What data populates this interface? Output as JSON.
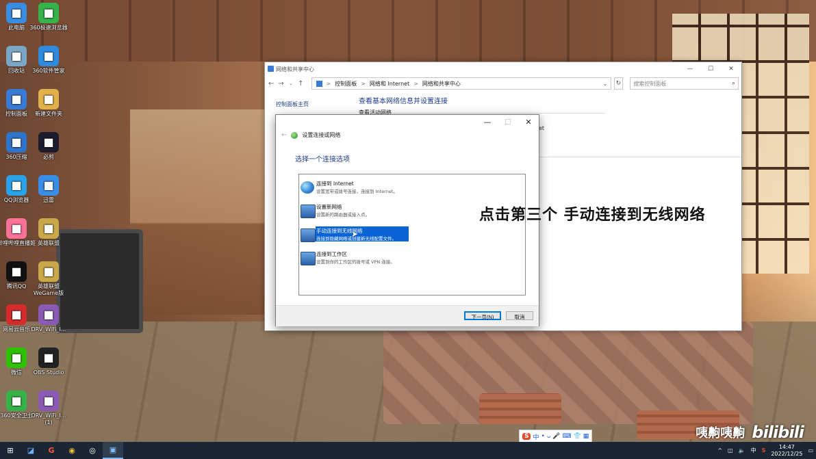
{
  "desktop": {
    "icons": [
      {
        "label": "此电脑",
        "icon": "computer-icon",
        "color": "#3a8de0"
      },
      {
        "label": "360极速浏览器",
        "icon": "browser-icon",
        "color": "#35b34a"
      },
      {
        "label": "回收站",
        "icon": "recycle-bin-icon",
        "color": "#7aa7c7"
      },
      {
        "label": "360软件管家",
        "icon": "software-manager-icon",
        "color": "#2e8be0"
      },
      {
        "label": "控制面板",
        "icon": "control-panel-icon",
        "color": "#3a7bd5"
      },
      {
        "label": "新建文件夹",
        "icon": "folder-icon",
        "color": "#e2b04a"
      },
      {
        "label": "360压缩",
        "icon": "archive-icon",
        "color": "#2f74c9"
      },
      {
        "label": "必剪",
        "icon": "bijian-icon",
        "color": "#1c1c2c"
      },
      {
        "label": "QQ浏览器",
        "icon": "qq-browser-icon",
        "color": "#2aa2e8"
      },
      {
        "label": "迅雷",
        "icon": "xunlei-icon",
        "color": "#3b8ee8"
      },
      {
        "label": "哔哩哔哩直播姬",
        "icon": "bilibili-live-icon",
        "color": "#fb7299"
      },
      {
        "label": "英雄联盟",
        "icon": "lol-icon",
        "color": "#c9a84a"
      },
      {
        "label": "腾讯QQ",
        "icon": "qq-icon",
        "color": "#111111"
      },
      {
        "label": "英雄联盟 WeGame版",
        "icon": "wegame-icon",
        "color": "#c9a84a"
      },
      {
        "label": "网易云音乐",
        "icon": "netease-music-icon",
        "color": "#d62b2b"
      },
      {
        "label": "DRV_WiFi_I...",
        "icon": "winrar-icon",
        "color": "#8a5ab5"
      },
      {
        "label": "微信",
        "icon": "wechat-icon",
        "color": "#2dc100"
      },
      {
        "label": "OBS Studio",
        "icon": "obs-icon",
        "color": "#222222"
      },
      {
        "label": "360安全卫士",
        "icon": "security-guard-icon",
        "color": "#35b34a"
      },
      {
        "label": "DRV_WiFi_I...(1)",
        "icon": "winrar-icon",
        "color": "#8a5ab5"
      }
    ]
  },
  "bg_window": {
    "title": "网络和共享中心",
    "address": {
      "segments": [
        "控制面板",
        "网络和 Internet",
        "网络和共享中心"
      ],
      "separator": ">"
    },
    "search_placeholder": "搜索控制面板",
    "left_pane_link": "控制面板主页",
    "main_heading": "查看基本网络信息并设置连接",
    "sub_heading": "查看活动网络",
    "right_partial": "et",
    "left_partial_chars": [
      "更",
      "I",
      "W"
    ]
  },
  "dialog": {
    "window_title": "设置连接或网络",
    "heading": "选择一个连接选项",
    "options": [
      {
        "title": "连接到 Internet",
        "desc": "设置宽带或拨号连接，连接到 Internet。"
      },
      {
        "title": "设置新网络",
        "desc": "设置新的路由器或接入点。"
      },
      {
        "title": "手动连接到无线网络",
        "desc": "连接到隐藏网络或创建新无线配置文件。"
      },
      {
        "title": "连接到工作区",
        "desc": "设置到你的工作区的拨号或 VPN 连接。"
      }
    ],
    "next_button": "下一页(N)",
    "cancel_button": "取消"
  },
  "caption": "点击第三个 手动连接到无线网络",
  "watermark": {
    "author": "咦齁咦齁",
    "brand": "bilibili"
  },
  "ime": {
    "logo": "S",
    "items": [
      "中",
      "•",
      "ᴗ",
      "🎤",
      "⌨",
      "👕",
      "▦"
    ]
  },
  "taskbar": {
    "items": [
      "windows-start-icon",
      "task-app-icon",
      "g-app-icon",
      "chrome-icon",
      "obs-task-icon",
      "control-panel-task-icon"
    ],
    "tray": {
      "chevron": "^",
      "ime_label": "中",
      "time": "14:47",
      "date": "2022/12/25"
    }
  }
}
